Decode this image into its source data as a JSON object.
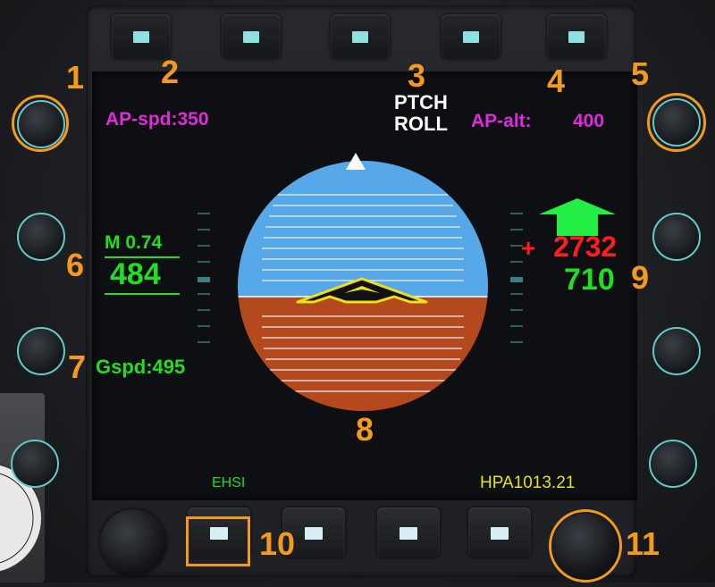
{
  "annotations": [
    "1",
    "2",
    "3",
    "4",
    "5",
    "6",
    "7",
    "8",
    "9",
    "10",
    "11"
  ],
  "display": {
    "ap_spd": "AP-spd:350",
    "mode_pitch": "PTCH",
    "mode_roll": "ROLL",
    "ap_alt_label": "AP-alt:",
    "ap_alt_value": "400",
    "mach": "M  0.74",
    "airspeed": "484",
    "ground_speed": "Gspd:495",
    "altitude_target_sign": "+",
    "altitude_target": "2732",
    "altitude": "710",
    "page_label": "EHSI",
    "baro": "HPA1013.21"
  },
  "colors": {
    "sky": "#57a8e8",
    "ground": "#b5491e",
    "orange_annotation": "#f39a1e",
    "magenta": "#e02adc",
    "green": "#22dd22",
    "red": "#ff1c1c",
    "yellow": "#e6e020",
    "lamp": "#8fe0e0"
  },
  "icons": {
    "aircraft_symbol": "aircraft-chevron-icon",
    "heading_pointer": "heading-triangle-icon",
    "vertical_speed_arrow": "up-arrow-icon"
  }
}
